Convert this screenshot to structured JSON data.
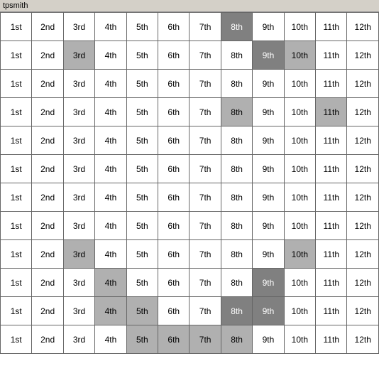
{
  "title": "tpsmith",
  "columns": [
    "1st",
    "2nd",
    "3rd",
    "4th",
    "5th",
    "6th",
    "7th",
    "8th",
    "9th",
    "10th",
    "11th",
    "12th"
  ],
  "rows": [
    {
      "cells": [
        {
          "text": "1st",
          "style": ""
        },
        {
          "text": "2nd",
          "style": ""
        },
        {
          "text": "3rd",
          "style": ""
        },
        {
          "text": "4th",
          "style": ""
        },
        {
          "text": "5th",
          "style": ""
        },
        {
          "text": "6th",
          "style": ""
        },
        {
          "text": "7th",
          "style": ""
        },
        {
          "text": "8th",
          "style": "highlighted-dark"
        },
        {
          "text": "9th",
          "style": ""
        },
        {
          "text": "10th",
          "style": ""
        },
        {
          "text": "11th",
          "style": ""
        },
        {
          "text": "12th",
          "style": ""
        }
      ]
    },
    {
      "cells": [
        {
          "text": "1st",
          "style": ""
        },
        {
          "text": "2nd",
          "style": ""
        },
        {
          "text": "3rd",
          "style": "highlighted-gray"
        },
        {
          "text": "4th",
          "style": ""
        },
        {
          "text": "5th",
          "style": ""
        },
        {
          "text": "6th",
          "style": ""
        },
        {
          "text": "7th",
          "style": ""
        },
        {
          "text": "8th",
          "style": ""
        },
        {
          "text": "9th",
          "style": "highlighted-dark"
        },
        {
          "text": "10th",
          "style": "highlighted-gray"
        },
        {
          "text": "11th",
          "style": ""
        },
        {
          "text": "12th",
          "style": ""
        }
      ]
    },
    {
      "cells": [
        {
          "text": "1st",
          "style": ""
        },
        {
          "text": "2nd",
          "style": ""
        },
        {
          "text": "3rd",
          "style": ""
        },
        {
          "text": "4th",
          "style": ""
        },
        {
          "text": "5th",
          "style": ""
        },
        {
          "text": "6th",
          "style": ""
        },
        {
          "text": "7th",
          "style": ""
        },
        {
          "text": "8th",
          "style": ""
        },
        {
          "text": "9th",
          "style": ""
        },
        {
          "text": "10th",
          "style": ""
        },
        {
          "text": "11th",
          "style": ""
        },
        {
          "text": "12th",
          "style": ""
        }
      ]
    },
    {
      "cells": [
        {
          "text": "1st",
          "style": ""
        },
        {
          "text": "2nd",
          "style": ""
        },
        {
          "text": "3rd",
          "style": ""
        },
        {
          "text": "4th",
          "style": ""
        },
        {
          "text": "5th",
          "style": ""
        },
        {
          "text": "6th",
          "style": ""
        },
        {
          "text": "7th",
          "style": ""
        },
        {
          "text": "8th",
          "style": "highlighted-gray"
        },
        {
          "text": "9th",
          "style": ""
        },
        {
          "text": "10th",
          "style": ""
        },
        {
          "text": "11th",
          "style": "highlighted-gray"
        },
        {
          "text": "12th",
          "style": ""
        }
      ]
    },
    {
      "cells": [
        {
          "text": "1st",
          "style": ""
        },
        {
          "text": "2nd",
          "style": ""
        },
        {
          "text": "3rd",
          "style": ""
        },
        {
          "text": "4th",
          "style": ""
        },
        {
          "text": "5th",
          "style": ""
        },
        {
          "text": "6th",
          "style": ""
        },
        {
          "text": "7th",
          "style": ""
        },
        {
          "text": "8th",
          "style": ""
        },
        {
          "text": "9th",
          "style": ""
        },
        {
          "text": "10th",
          "style": ""
        },
        {
          "text": "11th",
          "style": ""
        },
        {
          "text": "12th",
          "style": ""
        }
      ]
    },
    {
      "cells": [
        {
          "text": "1st",
          "style": ""
        },
        {
          "text": "2nd",
          "style": ""
        },
        {
          "text": "3rd",
          "style": ""
        },
        {
          "text": "4th",
          "style": ""
        },
        {
          "text": "5th",
          "style": ""
        },
        {
          "text": "6th",
          "style": ""
        },
        {
          "text": "7th",
          "style": ""
        },
        {
          "text": "8th",
          "style": ""
        },
        {
          "text": "9th",
          "style": ""
        },
        {
          "text": "10th",
          "style": ""
        },
        {
          "text": "11th",
          "style": ""
        },
        {
          "text": "12th",
          "style": ""
        }
      ]
    },
    {
      "cells": [
        {
          "text": "1st",
          "style": ""
        },
        {
          "text": "2nd",
          "style": ""
        },
        {
          "text": "3rd",
          "style": ""
        },
        {
          "text": "4th",
          "style": ""
        },
        {
          "text": "5th",
          "style": ""
        },
        {
          "text": "6th",
          "style": ""
        },
        {
          "text": "7th",
          "style": ""
        },
        {
          "text": "8th",
          "style": ""
        },
        {
          "text": "9th",
          "style": ""
        },
        {
          "text": "10th",
          "style": ""
        },
        {
          "text": "11th",
          "style": ""
        },
        {
          "text": "12th",
          "style": ""
        }
      ]
    },
    {
      "cells": [
        {
          "text": "1st",
          "style": ""
        },
        {
          "text": "2nd",
          "style": ""
        },
        {
          "text": "3rd",
          "style": ""
        },
        {
          "text": "4th",
          "style": ""
        },
        {
          "text": "5th",
          "style": ""
        },
        {
          "text": "6th",
          "style": ""
        },
        {
          "text": "7th",
          "style": ""
        },
        {
          "text": "8th",
          "style": ""
        },
        {
          "text": "9th",
          "style": ""
        },
        {
          "text": "10th",
          "style": ""
        },
        {
          "text": "11th",
          "style": ""
        },
        {
          "text": "12th",
          "style": ""
        }
      ]
    },
    {
      "cells": [
        {
          "text": "1st",
          "style": ""
        },
        {
          "text": "2nd",
          "style": ""
        },
        {
          "text": "3rd",
          "style": "highlighted-gray"
        },
        {
          "text": "4th",
          "style": ""
        },
        {
          "text": "5th",
          "style": ""
        },
        {
          "text": "6th",
          "style": ""
        },
        {
          "text": "7th",
          "style": ""
        },
        {
          "text": "8th",
          "style": ""
        },
        {
          "text": "9th",
          "style": ""
        },
        {
          "text": "10th",
          "style": "highlighted-gray"
        },
        {
          "text": "11th",
          "style": ""
        },
        {
          "text": "12th",
          "style": ""
        }
      ]
    },
    {
      "cells": [
        {
          "text": "1st",
          "style": ""
        },
        {
          "text": "2nd",
          "style": ""
        },
        {
          "text": "3rd",
          "style": ""
        },
        {
          "text": "4th",
          "style": "highlighted-gray"
        },
        {
          "text": "5th",
          "style": ""
        },
        {
          "text": "6th",
          "style": ""
        },
        {
          "text": "7th",
          "style": ""
        },
        {
          "text": "8th",
          "style": ""
        },
        {
          "text": "9th",
          "style": "highlighted-dark"
        },
        {
          "text": "10th",
          "style": ""
        },
        {
          "text": "11th",
          "style": ""
        },
        {
          "text": "12th",
          "style": ""
        }
      ]
    },
    {
      "cells": [
        {
          "text": "1st",
          "style": ""
        },
        {
          "text": "2nd",
          "style": ""
        },
        {
          "text": "3rd",
          "style": ""
        },
        {
          "text": "4th",
          "style": "highlighted-gray"
        },
        {
          "text": "5th",
          "style": "highlighted-gray"
        },
        {
          "text": "6th",
          "style": ""
        },
        {
          "text": "7th",
          "style": ""
        },
        {
          "text": "8th",
          "style": "highlighted-dark"
        },
        {
          "text": "9th",
          "style": "highlighted-dark"
        },
        {
          "text": "10th",
          "style": ""
        },
        {
          "text": "11th",
          "style": ""
        },
        {
          "text": "12th",
          "style": ""
        }
      ]
    },
    {
      "cells": [
        {
          "text": "1st",
          "style": ""
        },
        {
          "text": "2nd",
          "style": ""
        },
        {
          "text": "3rd",
          "style": ""
        },
        {
          "text": "4th",
          "style": ""
        },
        {
          "text": "5th",
          "style": "highlighted-gray"
        },
        {
          "text": "6th",
          "style": "highlighted-gray"
        },
        {
          "text": "7th",
          "style": "highlighted-gray"
        },
        {
          "text": "8th",
          "style": "highlighted-gray"
        },
        {
          "text": "9th",
          "style": ""
        },
        {
          "text": "10th",
          "style": ""
        },
        {
          "text": "11th",
          "style": ""
        },
        {
          "text": "12th",
          "style": ""
        }
      ]
    }
  ]
}
